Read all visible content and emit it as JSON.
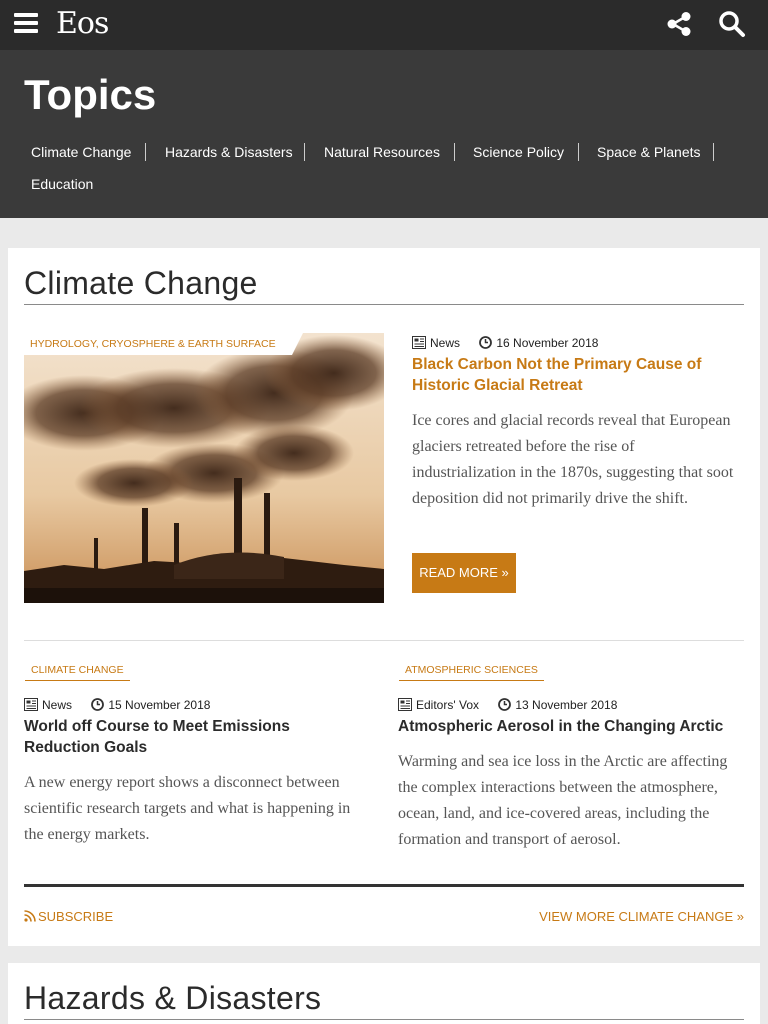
{
  "header": {
    "logo": "Eos",
    "icons": {
      "menu": "hamburger-menu-icon",
      "share": "share-icon",
      "search": "search-icon"
    }
  },
  "topics": {
    "title": "Topics",
    "links": [
      "Climate Change",
      "Hazards & Disasters",
      "Natural Resources",
      "Science Policy",
      "Space & Planets",
      "Education"
    ]
  },
  "sections": [
    {
      "title": "Climate Change",
      "featured": {
        "tag": "HYDROLOGY, CRYOSPHERE & EARTH SURFACE",
        "type": "News",
        "date": "16 November 2018",
        "title": "Black Carbon Not the Primary Cause of Historic Glacial Retreat",
        "summary": "Ice cores and glacial records reveal that European glaciers retreated before the rise of industrialization in the 1870s, suggesting that soot deposition did not primarily drive the shift.",
        "read_more": "READ MORE »"
      },
      "articles": [
        {
          "tag": "CLIMATE CHANGE",
          "type": "News",
          "date": "15 November 2018",
          "title": "World off Course to Meet Emissions Reduction Goals",
          "summary": "A new energy report shows a disconnect between scientific research targets and what is happening in the energy markets."
        },
        {
          "tag": "ATMOSPHERIC SCIENCES",
          "type": "Editors' Vox",
          "date": "13 November 2018",
          "title": "Atmospheric Aerosol in the Changing Arctic",
          "summary": "Warming and sea ice loss in the Arctic are affecting the complex interactions between the atmosphere, ocean, land, and ice-covered areas, including the formation and transport of aerosol."
        }
      ],
      "subscribe": "SUBSCRIBE",
      "view_more": "VIEW MORE CLIMATE CHANGE »"
    },
    {
      "title": "Hazards & Disasters"
    }
  ],
  "colors": {
    "accent": "#c77a15",
    "topbar": "#2b2b2b",
    "band": "#3a3a3a"
  }
}
